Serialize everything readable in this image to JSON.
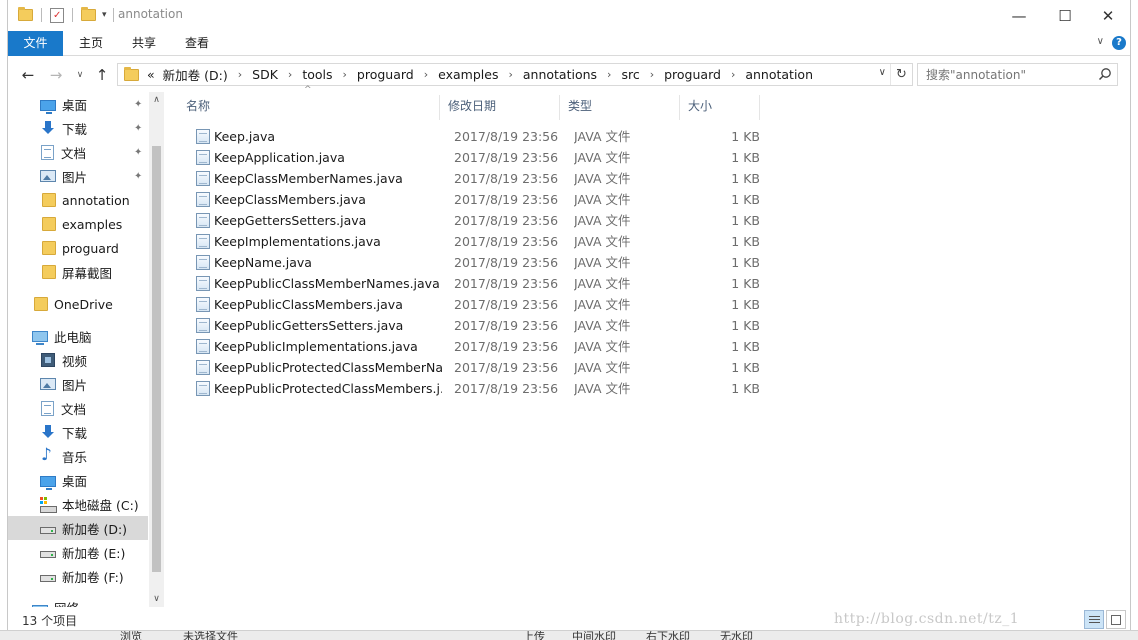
{
  "window": {
    "title": "annotation",
    "controls": {
      "minimize": "—",
      "maximize": "☐",
      "close": "✕"
    }
  },
  "ribbon": {
    "tabs": [
      "文件",
      "主页",
      "共享",
      "查看"
    ],
    "help": "?",
    "expand": "∨"
  },
  "address": {
    "overflow": "«",
    "segments": [
      "新加卷 (D:)",
      "SDK",
      "tools",
      "proguard",
      "examples",
      "annotations",
      "src",
      "proguard",
      "annotation"
    ],
    "dropdown": "∨",
    "refresh": "↻"
  },
  "search": {
    "placeholder": "搜索\"annotation\""
  },
  "sidebar": {
    "quick_access": [
      {
        "label": "桌面",
        "icon": "desktop-icon",
        "pinned": true
      },
      {
        "label": "下载",
        "icon": "download-icon",
        "pinned": true
      },
      {
        "label": "文档",
        "icon": "document-icon",
        "pinned": true
      },
      {
        "label": "图片",
        "icon": "picture-icon",
        "pinned": true
      },
      {
        "label": "annotation",
        "icon": "folder-icon",
        "pinned": false
      },
      {
        "label": "examples",
        "icon": "folder-icon",
        "pinned": false
      },
      {
        "label": "proguard",
        "icon": "folder-icon",
        "pinned": false
      },
      {
        "label": "屏幕截图",
        "icon": "folder-icon",
        "pinned": false
      }
    ],
    "onedrive": {
      "label": "OneDrive",
      "icon": "folder-icon"
    },
    "this_pc": {
      "label": "此电脑",
      "icon": "computer-icon"
    },
    "pc_items": [
      {
        "label": "视频",
        "icon": "video-icon"
      },
      {
        "label": "图片",
        "icon": "picture-icon"
      },
      {
        "label": "文档",
        "icon": "document-icon"
      },
      {
        "label": "下载",
        "icon": "download-icon"
      },
      {
        "label": "音乐",
        "icon": "music-icon"
      },
      {
        "label": "桌面",
        "icon": "desktop-icon"
      },
      {
        "label": "本地磁盘 (C:)",
        "icon": "system-drive-icon"
      },
      {
        "label": "新加卷 (D:)",
        "icon": "drive-icon",
        "selected": true
      },
      {
        "label": "新加卷 (E:)",
        "icon": "drive-icon"
      },
      {
        "label": "新加卷 (F:)",
        "icon": "drive-icon"
      }
    ],
    "network": {
      "label": "网络",
      "icon": "network-icon"
    },
    "pin_glyph": "📌"
  },
  "columns": {
    "name": "名称",
    "date": "修改日期",
    "type": "类型",
    "size": "大小",
    "sort_glyph": "^"
  },
  "files": [
    {
      "name": "Keep.java",
      "date": "2017/8/19 23:56",
      "type": "JAVA 文件",
      "size": "1 KB"
    },
    {
      "name": "KeepApplication.java",
      "date": "2017/8/19 23:56",
      "type": "JAVA 文件",
      "size": "1 KB"
    },
    {
      "name": "KeepClassMemberNames.java",
      "date": "2017/8/19 23:56",
      "type": "JAVA 文件",
      "size": "1 KB"
    },
    {
      "name": "KeepClassMembers.java",
      "date": "2017/8/19 23:56",
      "type": "JAVA 文件",
      "size": "1 KB"
    },
    {
      "name": "KeepGettersSetters.java",
      "date": "2017/8/19 23:56",
      "type": "JAVA 文件",
      "size": "1 KB"
    },
    {
      "name": "KeepImplementations.java",
      "date": "2017/8/19 23:56",
      "type": "JAVA 文件",
      "size": "1 KB"
    },
    {
      "name": "KeepName.java",
      "date": "2017/8/19 23:56",
      "type": "JAVA 文件",
      "size": "1 KB"
    },
    {
      "name": "KeepPublicClassMemberNames.java",
      "date": "2017/8/19 23:56",
      "type": "JAVA 文件",
      "size": "1 KB"
    },
    {
      "name": "KeepPublicClassMembers.java",
      "date": "2017/8/19 23:56",
      "type": "JAVA 文件",
      "size": "1 KB"
    },
    {
      "name": "KeepPublicGettersSetters.java",
      "date": "2017/8/19 23:56",
      "type": "JAVA 文件",
      "size": "1 KB"
    },
    {
      "name": "KeepPublicImplementations.java",
      "date": "2017/8/19 23:56",
      "type": "JAVA 文件",
      "size": "1 KB"
    },
    {
      "name": "KeepPublicProtectedClassMemberNa...",
      "date": "2017/8/19 23:56",
      "type": "JAVA 文件",
      "size": "1 KB"
    },
    {
      "name": "KeepPublicProtectedClassMembers.j...",
      "date": "2017/8/19 23:56",
      "type": "JAVA 文件",
      "size": "1 KB"
    }
  ],
  "status": {
    "item_count": "13 个项目"
  },
  "watermark": "http://blog.csdn.net/tz_1",
  "below_window": {
    "left_label": "浏览",
    "left_value": "未选择文件",
    "right_label": "上传",
    "opt_center": "中间水印",
    "opt_bottom_right": "右下水印",
    "opt_none": "无水印"
  },
  "colors": {
    "accent": "#1979ca",
    "folder": "#f4cc5c",
    "selection": "#d9d9d9",
    "header_text": "#4c607a"
  }
}
